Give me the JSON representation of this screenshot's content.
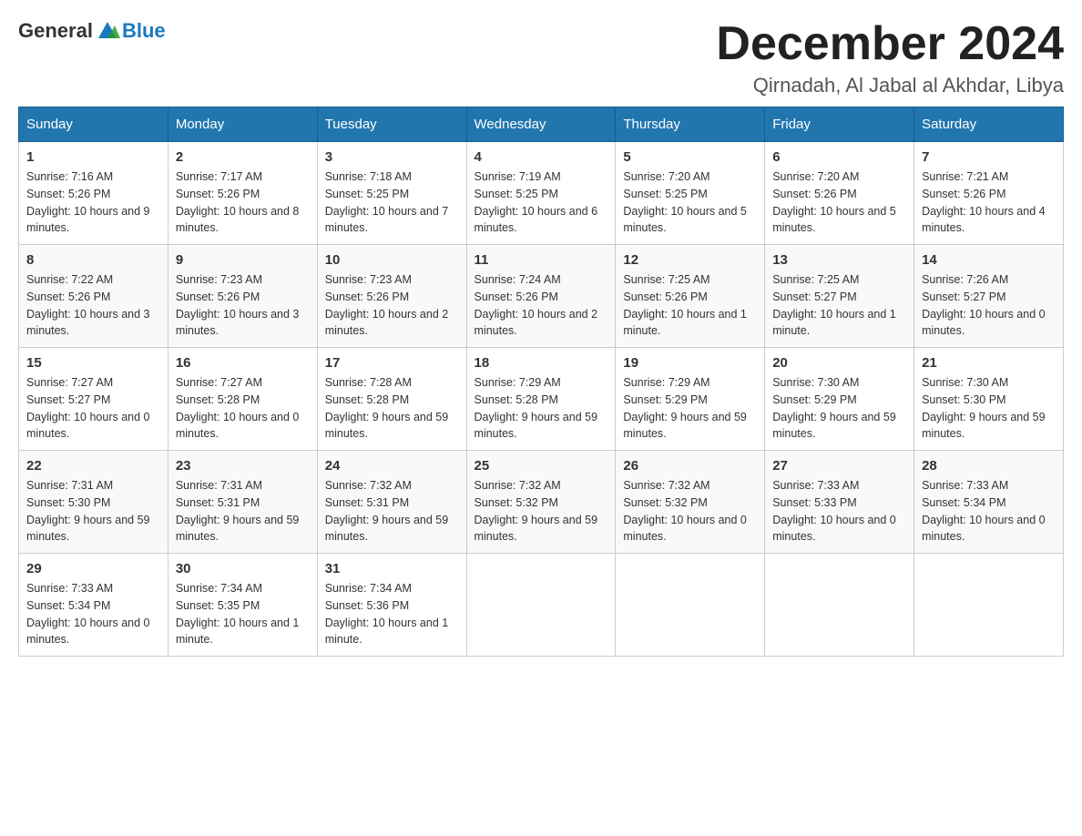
{
  "header": {
    "logo_general": "General",
    "logo_blue": "Blue",
    "month_title": "December 2024",
    "location": "Qirnadah, Al Jabal al Akhdar, Libya"
  },
  "days_of_week": [
    "Sunday",
    "Monday",
    "Tuesday",
    "Wednesday",
    "Thursday",
    "Friday",
    "Saturday"
  ],
  "weeks": [
    [
      {
        "day": "1",
        "sunrise": "7:16 AM",
        "sunset": "5:26 PM",
        "daylight": "10 hours and 9 minutes."
      },
      {
        "day": "2",
        "sunrise": "7:17 AM",
        "sunset": "5:26 PM",
        "daylight": "10 hours and 8 minutes."
      },
      {
        "day": "3",
        "sunrise": "7:18 AM",
        "sunset": "5:25 PM",
        "daylight": "10 hours and 7 minutes."
      },
      {
        "day": "4",
        "sunrise": "7:19 AM",
        "sunset": "5:25 PM",
        "daylight": "10 hours and 6 minutes."
      },
      {
        "day": "5",
        "sunrise": "7:20 AM",
        "sunset": "5:25 PM",
        "daylight": "10 hours and 5 minutes."
      },
      {
        "day": "6",
        "sunrise": "7:20 AM",
        "sunset": "5:26 PM",
        "daylight": "10 hours and 5 minutes."
      },
      {
        "day": "7",
        "sunrise": "7:21 AM",
        "sunset": "5:26 PM",
        "daylight": "10 hours and 4 minutes."
      }
    ],
    [
      {
        "day": "8",
        "sunrise": "7:22 AM",
        "sunset": "5:26 PM",
        "daylight": "10 hours and 3 minutes."
      },
      {
        "day": "9",
        "sunrise": "7:23 AM",
        "sunset": "5:26 PM",
        "daylight": "10 hours and 3 minutes."
      },
      {
        "day": "10",
        "sunrise": "7:23 AM",
        "sunset": "5:26 PM",
        "daylight": "10 hours and 2 minutes."
      },
      {
        "day": "11",
        "sunrise": "7:24 AM",
        "sunset": "5:26 PM",
        "daylight": "10 hours and 2 minutes."
      },
      {
        "day": "12",
        "sunrise": "7:25 AM",
        "sunset": "5:26 PM",
        "daylight": "10 hours and 1 minute."
      },
      {
        "day": "13",
        "sunrise": "7:25 AM",
        "sunset": "5:27 PM",
        "daylight": "10 hours and 1 minute."
      },
      {
        "day": "14",
        "sunrise": "7:26 AM",
        "sunset": "5:27 PM",
        "daylight": "10 hours and 0 minutes."
      }
    ],
    [
      {
        "day": "15",
        "sunrise": "7:27 AM",
        "sunset": "5:27 PM",
        "daylight": "10 hours and 0 minutes."
      },
      {
        "day": "16",
        "sunrise": "7:27 AM",
        "sunset": "5:28 PM",
        "daylight": "10 hours and 0 minutes."
      },
      {
        "day": "17",
        "sunrise": "7:28 AM",
        "sunset": "5:28 PM",
        "daylight": "9 hours and 59 minutes."
      },
      {
        "day": "18",
        "sunrise": "7:29 AM",
        "sunset": "5:28 PM",
        "daylight": "9 hours and 59 minutes."
      },
      {
        "day": "19",
        "sunrise": "7:29 AM",
        "sunset": "5:29 PM",
        "daylight": "9 hours and 59 minutes."
      },
      {
        "day": "20",
        "sunrise": "7:30 AM",
        "sunset": "5:29 PM",
        "daylight": "9 hours and 59 minutes."
      },
      {
        "day": "21",
        "sunrise": "7:30 AM",
        "sunset": "5:30 PM",
        "daylight": "9 hours and 59 minutes."
      }
    ],
    [
      {
        "day": "22",
        "sunrise": "7:31 AM",
        "sunset": "5:30 PM",
        "daylight": "9 hours and 59 minutes."
      },
      {
        "day": "23",
        "sunrise": "7:31 AM",
        "sunset": "5:31 PM",
        "daylight": "9 hours and 59 minutes."
      },
      {
        "day": "24",
        "sunrise": "7:32 AM",
        "sunset": "5:31 PM",
        "daylight": "9 hours and 59 minutes."
      },
      {
        "day": "25",
        "sunrise": "7:32 AM",
        "sunset": "5:32 PM",
        "daylight": "9 hours and 59 minutes."
      },
      {
        "day": "26",
        "sunrise": "7:32 AM",
        "sunset": "5:32 PM",
        "daylight": "10 hours and 0 minutes."
      },
      {
        "day": "27",
        "sunrise": "7:33 AM",
        "sunset": "5:33 PM",
        "daylight": "10 hours and 0 minutes."
      },
      {
        "day": "28",
        "sunrise": "7:33 AM",
        "sunset": "5:34 PM",
        "daylight": "10 hours and 0 minutes."
      }
    ],
    [
      {
        "day": "29",
        "sunrise": "7:33 AM",
        "sunset": "5:34 PM",
        "daylight": "10 hours and 0 minutes."
      },
      {
        "day": "30",
        "sunrise": "7:34 AM",
        "sunset": "5:35 PM",
        "daylight": "10 hours and 1 minute."
      },
      {
        "day": "31",
        "sunrise": "7:34 AM",
        "sunset": "5:36 PM",
        "daylight": "10 hours and 1 minute."
      },
      null,
      null,
      null,
      null
    ]
  ]
}
